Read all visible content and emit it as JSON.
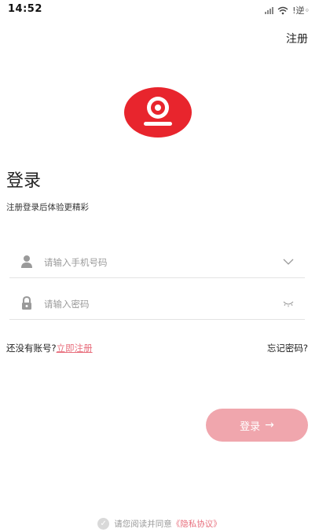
{
  "status_bar": {
    "time": "14:52",
    "extra": "!逆◦"
  },
  "top_register_label": "注册",
  "title": "登录",
  "subtitle": "注册登录后体验更精彩",
  "form": {
    "phone_placeholder": "请输入手机号码",
    "password_placeholder": "请输入密码"
  },
  "links": {
    "no_account": "还没有账号?",
    "register_now": "立即注册",
    "forgot_password": "忘记密码?"
  },
  "login_button": {
    "label": "登录",
    "arrow": "→"
  },
  "agreement": {
    "text": "请您阅读并同意",
    "link": "《隐私协议》"
  },
  "colors": {
    "brand_red": "#e8252d",
    "button_pink": "#f0a6ad",
    "link_red": "#e86f7d",
    "placeholder_gray": "#9a9a9a"
  },
  "icons": [
    "signal-icon",
    "wifi-icon",
    "logo-icon",
    "user-icon",
    "lock-icon",
    "chevron-down-icon",
    "eye-closed-icon",
    "arrow-right-icon",
    "check-icon"
  ]
}
